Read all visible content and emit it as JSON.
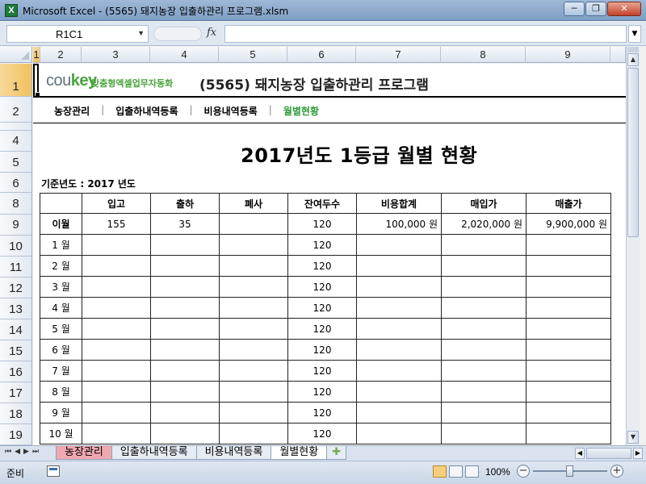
{
  "window": {
    "title": "Microsoft Excel - (5565) 돼지농장 입출하관리 프로그램.xlsm",
    "app_icon": "X",
    "minimize_label": "─",
    "restore_label": "❐",
    "close_label": "✕"
  },
  "formula_bar": {
    "name_box": "R1C1",
    "fx_label": "fx",
    "formula": ""
  },
  "columns": [
    "1",
    "2",
    "3",
    "4",
    "5",
    "6",
    "7",
    "8",
    "9"
  ],
  "rows": [
    "1",
    "2",
    "4",
    "5",
    "6",
    "8",
    "9",
    "10",
    "11",
    "12",
    "13",
    "14",
    "15",
    "16",
    "17",
    "18",
    "19"
  ],
  "header": {
    "brand_prefix": "cou",
    "brand_key": "key",
    "brand_sub": "맞춤형엑셀업무자동화",
    "app_title": "(5565) 돼지농장 입출하관리 프로그램"
  },
  "nav": {
    "items": [
      {
        "label": "농장관리",
        "active": false
      },
      {
        "label": "입출하내역등록",
        "active": false
      },
      {
        "label": "비용내역등록",
        "active": false
      },
      {
        "label": "월별현황",
        "active": true
      }
    ],
    "separator": "|"
  },
  "report": {
    "title": "2017년도 1등급 월별 현황",
    "base_year": "기준년도 : 2017 년도",
    "headers": [
      "",
      "입고",
      "출하",
      "폐사",
      "잔여두수",
      "비용합계",
      "매입가",
      "매출가"
    ],
    "rows": [
      {
        "label": "이월",
        "in": "155",
        "out": "35",
        "dead": "",
        "remain": "120",
        "cost": "100,000 원",
        "buy": "2,020,000 원",
        "sell": "9,900,000 원"
      },
      {
        "label": "1 월",
        "in": "",
        "out": "",
        "dead": "",
        "remain": "120",
        "cost": "",
        "buy": "",
        "sell": ""
      },
      {
        "label": "2 월",
        "in": "",
        "out": "",
        "dead": "",
        "remain": "120",
        "cost": "",
        "buy": "",
        "sell": ""
      },
      {
        "label": "3 월",
        "in": "",
        "out": "",
        "dead": "",
        "remain": "120",
        "cost": "",
        "buy": "",
        "sell": ""
      },
      {
        "label": "4 월",
        "in": "",
        "out": "",
        "dead": "",
        "remain": "120",
        "cost": "",
        "buy": "",
        "sell": ""
      },
      {
        "label": "5 월",
        "in": "",
        "out": "",
        "dead": "",
        "remain": "120",
        "cost": "",
        "buy": "",
        "sell": ""
      },
      {
        "label": "6 월",
        "in": "",
        "out": "",
        "dead": "",
        "remain": "120",
        "cost": "",
        "buy": "",
        "sell": ""
      },
      {
        "label": "7 월",
        "in": "",
        "out": "",
        "dead": "",
        "remain": "120",
        "cost": "",
        "buy": "",
        "sell": ""
      },
      {
        "label": "8 월",
        "in": "",
        "out": "",
        "dead": "",
        "remain": "120",
        "cost": "",
        "buy": "",
        "sell": ""
      },
      {
        "label": "9 월",
        "in": "",
        "out": "",
        "dead": "",
        "remain": "120",
        "cost": "",
        "buy": "",
        "sell": ""
      },
      {
        "label": "10 월",
        "in": "",
        "out": "",
        "dead": "",
        "remain": "120",
        "cost": "",
        "buy": "",
        "sell": ""
      }
    ]
  },
  "sheet_tabs": {
    "tabs": [
      {
        "label": "농장관리",
        "style": "red"
      },
      {
        "label": "입출하내역등록",
        "style": ""
      },
      {
        "label": "비용내역등록",
        "style": ""
      },
      {
        "label": "월별현황",
        "style": "active"
      }
    ]
  },
  "status_bar": {
    "status": "준비",
    "zoom": "100%"
  },
  "colors": {
    "brand_green": "#4aa33c",
    "active_nav": "#2e9a3a",
    "tab_red": "#f0a8b0"
  }
}
